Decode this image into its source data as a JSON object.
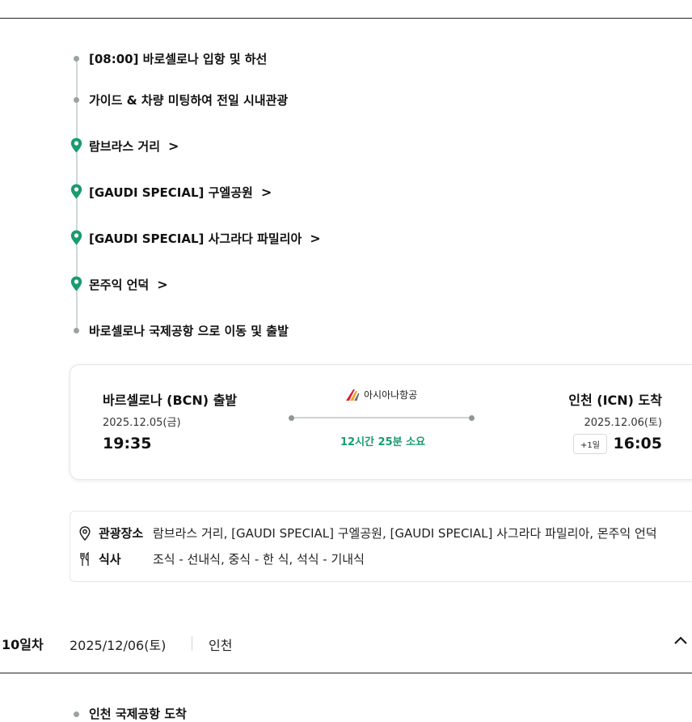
{
  "timeline": {
    "items": [
      {
        "text": "[08:00] 바로셀로나 입항 및 하선",
        "marker": "dot"
      },
      {
        "text": "가이드 & 차량 미팅하여 전일 시내관광",
        "marker": "dot"
      },
      {
        "text": "람브라스 거리",
        "marker": "pin"
      },
      {
        "text": "[GAUDI SPECIAL] 구엘공원",
        "marker": "pin"
      },
      {
        "text": "[GAUDI SPECIAL] 사그라다 파밀리아",
        "marker": "pin"
      },
      {
        "text": "몬주익 언덕",
        "marker": "pin"
      },
      {
        "text": "바로셀로나 국제공항 으로 이동 및 출발",
        "marker": "dot"
      }
    ],
    "chevron": ">"
  },
  "flight": {
    "departure_city": "바르셀로나 (BCN) 출발",
    "departure_date": "2025.12.05(금)",
    "departure_time": "19:35",
    "airline": "아시아나항공",
    "duration": "12시간 25분 소요",
    "arrival_city": "인천 (ICN) 도착",
    "arrival_date": "2025.12.06(토)",
    "arrival_plus_day": "+1일",
    "arrival_time": "16:05"
  },
  "info": {
    "sights_label": "관광장소",
    "sights_value": "람브라스 거리, [GAUDI SPECIAL] 구엘공원, [GAUDI SPECIAL] 사그라다 파밀리아, 몬주익 언덕",
    "meals_label": "식사",
    "meals_value": "조식 - 선내식, 중식 - 한 식, 석식 - 기내식"
  },
  "day": {
    "number": "10일차",
    "date": "2025/12/06(토)",
    "city": "인천"
  },
  "next_day_items": [
    {
      "text": "인천 국제공항 도착"
    }
  ],
  "colors": {
    "accent": "#1a9c6e",
    "pin": "#1a9c6e",
    "airline_red": "#d71f3a",
    "airline_orange": "#f3a21c"
  },
  "icons": {
    "pin": "map-pin-icon",
    "location": "location-icon",
    "meal": "fork-knife-icon",
    "toggle": "chevron-up-icon"
  }
}
